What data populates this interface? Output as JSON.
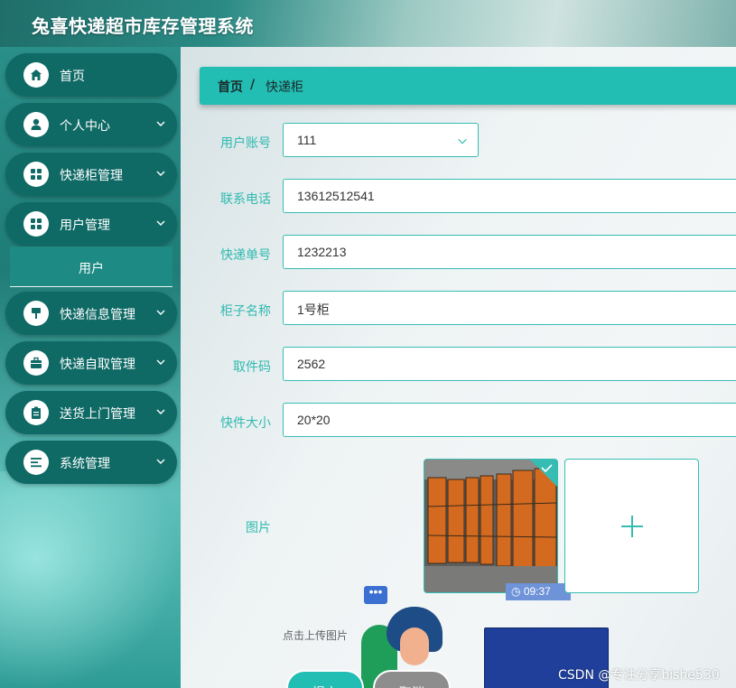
{
  "app": {
    "title": "兔喜快递超市库存管理系统"
  },
  "sidebar": {
    "items": [
      {
        "label": "首页",
        "icon": "home-icon",
        "has_chevron": false
      },
      {
        "label": "个人中心",
        "icon": "user-icon",
        "has_chevron": true
      },
      {
        "label": "快递柜管理",
        "icon": "grid-icon",
        "has_chevron": true
      },
      {
        "label": "用户管理",
        "icon": "grid-icon",
        "has_chevron": true
      },
      {
        "label": "快递信息管理",
        "icon": "brush-icon",
        "has_chevron": true
      },
      {
        "label": "快递自取管理",
        "icon": "briefcase-icon",
        "has_chevron": true
      },
      {
        "label": "送货上门管理",
        "icon": "clipboard-icon",
        "has_chevron": true
      },
      {
        "label": "系统管理",
        "icon": "list-icon",
        "has_chevron": true
      }
    ],
    "submenu": {
      "label": "用户"
    }
  },
  "breadcrumb": {
    "home": "首页",
    "separator": "/",
    "current": "快递柜"
  },
  "form": {
    "user_account": {
      "label": "用户账号",
      "value": "111"
    },
    "phone": {
      "label": "联系电话",
      "value": "13612512541"
    },
    "tracking_no": {
      "label": "快递单号",
      "value": "1232213"
    },
    "locker_name": {
      "label": "柜子名称",
      "value": "1号柜"
    },
    "pickup_code": {
      "label": "取件码",
      "value": "2562"
    },
    "size": {
      "label": "快件大小",
      "value": "20*20"
    },
    "image": {
      "label": "图片",
      "hint": "点击上传图片",
      "overlay_time": "09:37"
    }
  },
  "buttons": {
    "submit": "提交",
    "cancel": "取消"
  },
  "watermark": "CSDN @专注分享bishe530",
  "colors": {
    "accent": "#22bdb3",
    "sidebar_item": "#0f6a66",
    "label": "#2fbab0"
  }
}
